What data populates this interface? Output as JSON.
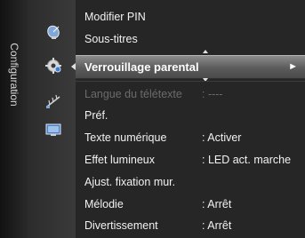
{
  "sidebar": {
    "label": "Configuration"
  },
  "icons": [
    {
      "name": "satellite-dish-icon"
    },
    {
      "name": "gear-icon"
    },
    {
      "name": "antenna-icon"
    },
    {
      "name": "input-icon"
    }
  ],
  "menu": {
    "top_items": [
      {
        "label": "Modifier PIN"
      },
      {
        "label": "Sous-titres"
      }
    ],
    "selected": {
      "label": "Verrouillage parental",
      "arrow": "►"
    },
    "items": [
      {
        "label": "Langue du télétexte",
        "value": ": ----",
        "disabled": true
      },
      {
        "label": "Préf.",
        "value": ""
      },
      {
        "label": "Texte numérique",
        "value": ": Activer"
      },
      {
        "label": "Effet lumineux",
        "value": ": LED act. marche"
      },
      {
        "label": "Ajust. fixation mur.",
        "value": ""
      },
      {
        "label": "Mélodie",
        "value": ": Arrêt"
      },
      {
        "label": "Divertissement",
        "value": ": Arrêt"
      }
    ]
  },
  "colors": {
    "background": "#262626",
    "highlight": "#6e6e6e",
    "text": "#f2f2f2",
    "disabled_text": "#6b6b6b"
  }
}
